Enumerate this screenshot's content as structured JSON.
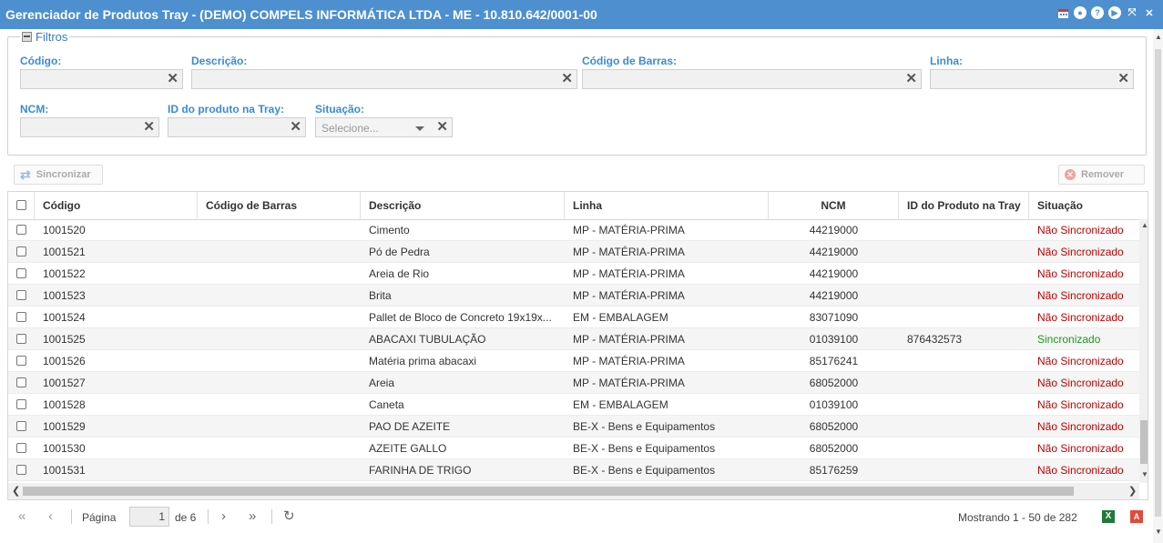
{
  "window": {
    "title": "Gerenciador de Produtos Tray - (DEMO) COMPELS INFORMÁTICA LTDA - ME - 10.810.642/0001-00",
    "icons": [
      "calendar-icon",
      "minimize-icon",
      "help-icon",
      "play-icon",
      "fullscreen-icon",
      "close-icon"
    ]
  },
  "filters": {
    "legend": "Filtros",
    "codigo_label": "Código:",
    "descricao_label": "Descrição:",
    "codigo_barras_label": "Código de Barras:",
    "linha_label": "Linha:",
    "ncm_label": "NCM:",
    "id_tray_label": "ID do produto na Tray:",
    "situacao_label": "Situação:",
    "situacao_placeholder": "Selecione...",
    "clear_glyph": "✕"
  },
  "toolbar": {
    "sync_label": "Sincronizar",
    "remove_label": "Remover"
  },
  "grid": {
    "columns": [
      "Código",
      "Código de Barras",
      "Descrição",
      "Linha",
      "NCM",
      "ID do Produto na Tray",
      "Situação"
    ],
    "rows": [
      {
        "codigo": "1001520",
        "barras": "",
        "descricao": "Cimento",
        "linha": "MP - MATÉRIA-PRIMA",
        "ncm": "44219000",
        "id_tray": "",
        "situacao": "Não Sincronizado",
        "synced": false
      },
      {
        "codigo": "1001521",
        "barras": "",
        "descricao": "Pó de Pedra",
        "linha": "MP - MATÉRIA-PRIMA",
        "ncm": "44219000",
        "id_tray": "",
        "situacao": "Não Sincronizado",
        "synced": false
      },
      {
        "codigo": "1001522",
        "barras": "",
        "descricao": "Areia de Rio",
        "linha": "MP - MATÉRIA-PRIMA",
        "ncm": "44219000",
        "id_tray": "",
        "situacao": "Não Sincronizado",
        "synced": false
      },
      {
        "codigo": "1001523",
        "barras": "",
        "descricao": "Brita",
        "linha": "MP - MATÉRIA-PRIMA",
        "ncm": "44219000",
        "id_tray": "",
        "situacao": "Não Sincronizado",
        "synced": false
      },
      {
        "codigo": "1001524",
        "barras": "",
        "descricao": "Pallet de Bloco de Concreto 19x19x...",
        "linha": "EM - EMBALAGEM",
        "ncm": "83071090",
        "id_tray": "",
        "situacao": "Não Sincronizado",
        "synced": false
      },
      {
        "codigo": "1001525",
        "barras": "",
        "descricao": "ABACAXI TUBULAÇÃO",
        "linha": "MP - MATÉRIA-PRIMA",
        "ncm": "01039100",
        "id_tray": "876432573",
        "situacao": "Sincronizado",
        "synced": true
      },
      {
        "codigo": "1001526",
        "barras": "",
        "descricao": "Matéria prima abacaxi",
        "linha": "MP - MATÉRIA-PRIMA",
        "ncm": "85176241",
        "id_tray": "",
        "situacao": "Não Sincronizado",
        "synced": false
      },
      {
        "codigo": "1001527",
        "barras": "",
        "descricao": "Areia",
        "linha": "MP - MATÉRIA-PRIMA",
        "ncm": "68052000",
        "id_tray": "",
        "situacao": "Não Sincronizado",
        "synced": false
      },
      {
        "codigo": "1001528",
        "barras": "",
        "descricao": "Caneta",
        "linha": "EM - EMBALAGEM",
        "ncm": "01039100",
        "id_tray": "",
        "situacao": "Não Sincronizado",
        "synced": false
      },
      {
        "codigo": "1001529",
        "barras": "",
        "descricao": "PAO DE AZEITE",
        "linha": "BE-X - Bens e Equipamentos",
        "ncm": "68052000",
        "id_tray": "",
        "situacao": "Não Sincronizado",
        "synced": false
      },
      {
        "codigo": "1001530",
        "barras": "",
        "descricao": "AZEITE GALLO",
        "linha": "BE-X - Bens e Equipamentos",
        "ncm": "68052000",
        "id_tray": "",
        "situacao": "Não Sincronizado",
        "synced": false
      },
      {
        "codigo": "1001531",
        "barras": "",
        "descricao": "FARINHA DE TRIGO",
        "linha": "BE-X - Bens e Equipamentos",
        "ncm": "85176259",
        "id_tray": "",
        "situacao": "Não Sincronizado",
        "synced": false
      }
    ]
  },
  "pager": {
    "page_label": "Página",
    "current_page": "1",
    "of_label": "de 6",
    "summary": "Mostrando 1 - 50 de 282"
  },
  "colors": {
    "titlebar": "#4e8fd0",
    "label_blue": "#3c8ad6",
    "not_synced": "#c00000",
    "synced": "#1a9a1a"
  }
}
